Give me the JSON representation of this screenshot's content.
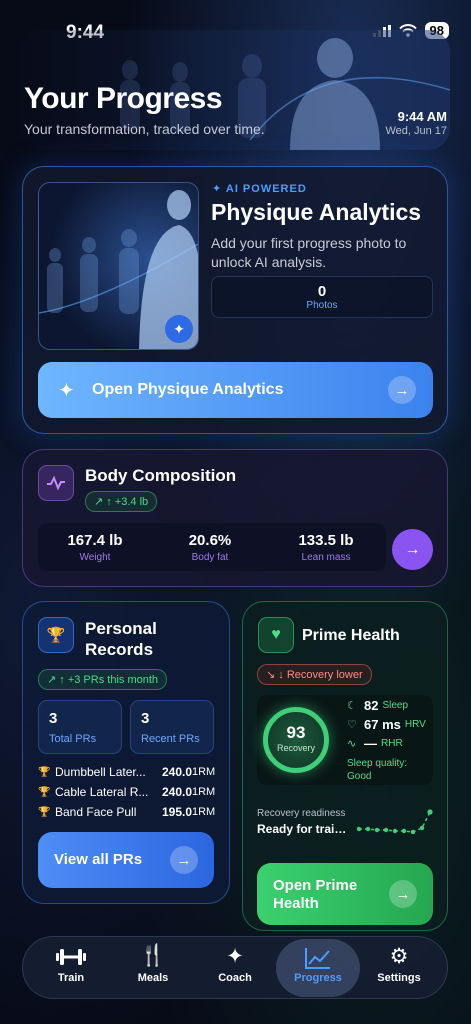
{
  "status": {
    "time": "9:44",
    "battery": "98"
  },
  "header": {
    "title": "Your Progress",
    "subtitle": "Your transformation, tracked over time.",
    "time": "9:44 AM",
    "date": "Wed, Jun 17"
  },
  "physique": {
    "badge": "AI POWERED",
    "title": "Physique Analytics",
    "description": "Add your first progress photo to unlock AI analysis.",
    "photos_value": "0",
    "photos_label": "Photos",
    "button_label": "Open Physique Analytics"
  },
  "body_composition": {
    "title": "Body Composition",
    "change": "↑ +3.4 lb",
    "stats": [
      {
        "value": "167.4 lb",
        "label": "Weight"
      },
      {
        "value": "20.6%",
        "label": "Body fat"
      },
      {
        "value": "133.5 lb",
        "label": "Lean mass"
      }
    ]
  },
  "personal_records": {
    "title": "Personal Records",
    "pill": "↑ +3 PRs this month",
    "total_value": "3",
    "total_label": "Total PRs",
    "recent_value": "3",
    "recent_label": "Recent PRs",
    "rows": [
      {
        "name": "Dumbbell Later...",
        "weight": "240.0",
        "unit": "1RM"
      },
      {
        "name": "Cable Lateral R...",
        "weight": "240.0",
        "unit": "1RM"
      },
      {
        "name": "Band Face Pull",
        "weight": "195.0",
        "unit": "1RM"
      }
    ],
    "button_label": "View all PRs"
  },
  "prime_health": {
    "title": "Prime Health",
    "pill": "↓ Recovery lower",
    "recovery_value": "93",
    "recovery_label": "Recovery",
    "sleep_value": "82",
    "sleep_label": "Sleep",
    "hrv_value": "67 ms",
    "hrv_label": "HRV",
    "rhr_value": "—",
    "rhr_label": "RHR",
    "sleep_quality": "Sleep quality: Good",
    "readiness_label": "Recovery readiness",
    "readiness_value": "Ready for training",
    "button_label": "Open Prime Health"
  },
  "tabs": [
    {
      "label": "Train",
      "icon": "dumbbell-icon"
    },
    {
      "label": "Meals",
      "icon": "fork-knife-icon"
    },
    {
      "label": "Coach",
      "icon": "sparkle-icon"
    },
    {
      "label": "Progress",
      "icon": "chart-icon",
      "active": true
    },
    {
      "label": "Settings",
      "icon": "gear-icon"
    }
  ],
  "colors": {
    "accent_blue": "#4f9cff",
    "accent_purple": "#8a54f0",
    "accent_green": "#3bd16f",
    "warning_red": "#ff8a80"
  }
}
